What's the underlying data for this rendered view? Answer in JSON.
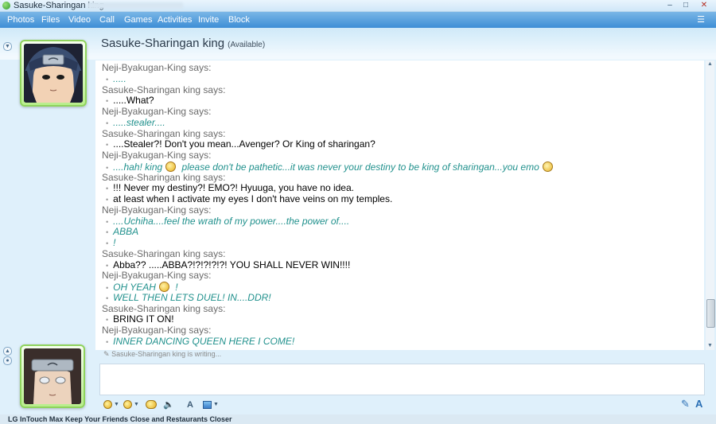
{
  "window": {
    "title": "Sasuke-Sharingan king",
    "min_glyph": "–",
    "max_glyph": "□",
    "close_glyph": "✕"
  },
  "menu": [
    {
      "label": "Photos"
    },
    {
      "label": "Files"
    },
    {
      "label": "Video"
    },
    {
      "label": "Call"
    },
    {
      "label": "Games"
    },
    {
      "label": "Activities"
    },
    {
      "label": "Invite"
    },
    {
      "label": "Block"
    }
  ],
  "contact": {
    "name": "Sasuke-Sharingan king",
    "status": "(Available)"
  },
  "conversation": [
    {
      "type": "says",
      "text": "Neji-Byakugan-King says:"
    },
    {
      "type": "msg",
      "speaker": "neji",
      "text": "....."
    },
    {
      "type": "says",
      "text": "Sasuke-Sharingan king says:"
    },
    {
      "type": "msg",
      "speaker": "sasuke",
      "text": ".....What?"
    },
    {
      "type": "says",
      "text": "Neji-Byakugan-King says:"
    },
    {
      "type": "msg",
      "speaker": "neji",
      "text": ".....stealer...."
    },
    {
      "type": "says",
      "text": "Sasuke-Sharingan king says:"
    },
    {
      "type": "msg",
      "speaker": "sasuke",
      "text": "....Stealer?! Don't you mean...Avenger? Or King of sharingan?"
    },
    {
      "type": "says",
      "text": "Neji-Byakugan-King says:"
    },
    {
      "type": "msg",
      "speaker": "neji",
      "text": "....hah! king",
      "emoticon": "thinking",
      "text2": " please don't be pathetic...it was never your destiny to be king of sharingan...you emo",
      "emoticon2": "eye-roll"
    },
    {
      "type": "says",
      "text": "Sasuke-Sharingan king says:"
    },
    {
      "type": "msg",
      "speaker": "sasuke",
      "text": "!!! Never my destiny?! EMO?! Hyuuga, you have no idea."
    },
    {
      "type": "msg",
      "speaker": "sasuke",
      "text": "at least when I activate my eyes I don't have veins on my temples."
    },
    {
      "type": "says",
      "text": "Neji-Byakugan-King says:"
    },
    {
      "type": "msg",
      "speaker": "neji",
      "text": "....Uchiha....feel the wrath of my power....the power of...."
    },
    {
      "type": "msg",
      "speaker": "neji",
      "text": "ABBA"
    },
    {
      "type": "msg",
      "speaker": "neji",
      "text": "!"
    },
    {
      "type": "says",
      "text": "Sasuke-Sharingan king says:"
    },
    {
      "type": "msg",
      "speaker": "sasuke",
      "text": "Abba?? .....ABBA?!?!?!?!?! YOU SHALL NEVER WIN!!!!"
    },
    {
      "type": "says",
      "text": "Neji-Byakugan-King says:"
    },
    {
      "type": "msg",
      "speaker": "neji",
      "text": "OH YEAH",
      "emoticon": "thinking",
      "text2": " !"
    },
    {
      "type": "msg",
      "speaker": "neji",
      "text": "WELL THEN LETS DUEL! IN....DDR!"
    },
    {
      "type": "says",
      "text": "Sasuke-Sharingan king says:"
    },
    {
      "type": "msg",
      "speaker": "sasuke",
      "text": "BRING IT ON!"
    },
    {
      "type": "says",
      "text": "Neji-Byakugan-King says:"
    },
    {
      "type": "msg",
      "speaker": "neji",
      "text": "INNER DANCING QUEEN HERE I COME!"
    }
  ],
  "typing_status": "Sasuke-Sharingan king is writing...",
  "composer": {
    "value": "",
    "toolbar": [
      {
        "name": "emoticon-button",
        "icon": "smiley-icon"
      },
      {
        "name": "wink-button",
        "icon": "wink-icon"
      },
      {
        "name": "nudge-button",
        "icon": "nudge-icon"
      },
      {
        "name": "voice-clip-button",
        "icon": "voice-icon"
      },
      {
        "name": "font-button",
        "icon": "font-icon"
      },
      {
        "name": "background-button",
        "icon": "background-icon"
      }
    ],
    "handwriting_glyph": "✎",
    "font_glyph": "A"
  },
  "ad": {
    "text": "LG InTouch Max Keep Your Friends Close and Restaurants Closer"
  },
  "colors": {
    "sasuke_text": "#000000",
    "neji_text": "#21918d",
    "says_text": "#6b6b6b",
    "menu_bar": "#3d8ed6"
  }
}
